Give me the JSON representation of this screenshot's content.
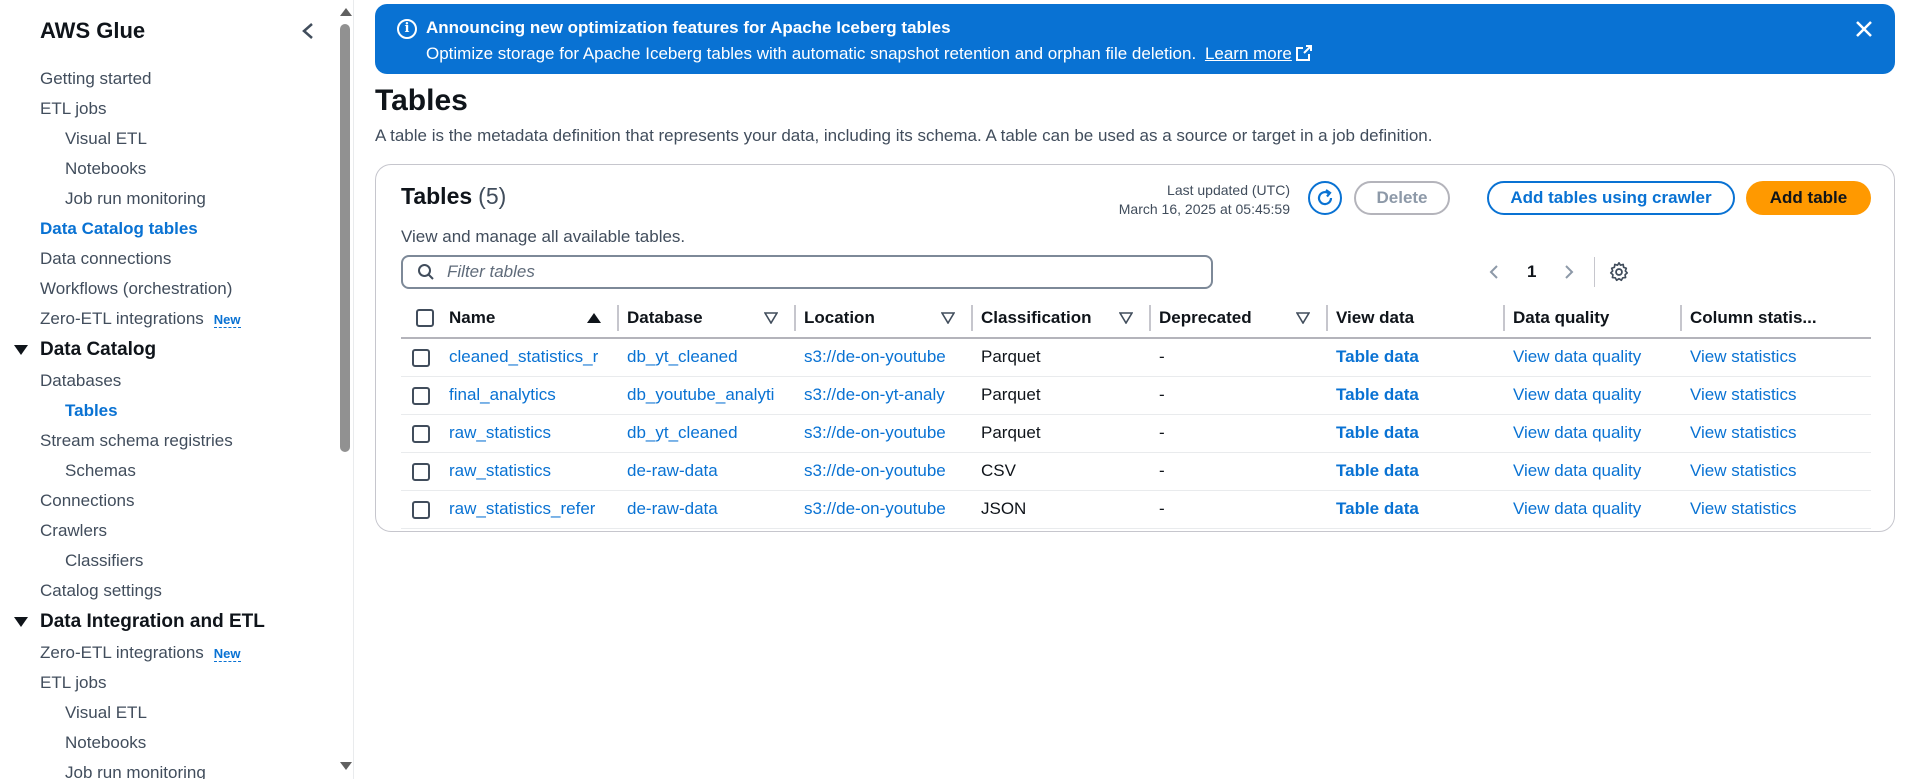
{
  "sidebar": {
    "title": "AWS Glue",
    "items": [
      {
        "label": "Getting started"
      },
      {
        "label": "ETL jobs"
      },
      {
        "label": "Visual ETL"
      },
      {
        "label": "Notebooks"
      },
      {
        "label": "Job run monitoring"
      },
      {
        "label": "Data Catalog tables"
      },
      {
        "label": "Data connections"
      },
      {
        "label": "Workflows (orchestration)"
      },
      {
        "label": "Zero-ETL integrations",
        "badge": "New"
      }
    ],
    "section_catalog": {
      "label": "Data Catalog",
      "items": [
        {
          "label": "Databases"
        },
        {
          "label": "Tables"
        },
        {
          "label": "Stream schema registries"
        },
        {
          "label": "Schemas"
        },
        {
          "label": "Connections"
        },
        {
          "label": "Crawlers"
        },
        {
          "label": "Classifiers"
        },
        {
          "label": "Catalog settings"
        }
      ]
    },
    "section_integration": {
      "label": "Data Integration and ETL",
      "items": [
        {
          "label": "Zero-ETL integrations",
          "badge": "New"
        },
        {
          "label": "ETL jobs"
        },
        {
          "label": "Visual ETL"
        },
        {
          "label": "Notebooks"
        },
        {
          "label": "Job run monitoring"
        }
      ]
    }
  },
  "banner": {
    "title": "Announcing new optimization features for Apache Iceberg tables",
    "text": "Optimize storage for Apache Iceberg tables with automatic snapshot retention and orphan file deletion.",
    "link": "Learn more",
    "color": "#0972d3"
  },
  "page": {
    "title": "Tables",
    "description": "A table is the metadata definition that represents your data, including its schema. A table can be used as a source or target in a job definition."
  },
  "tables_panel": {
    "title": "Tables",
    "count": "(5)",
    "description": "View and manage all available tables.",
    "last_updated_label": "Last updated (UTC)",
    "last_updated_value": "March 16, 2025 at 05:45:59",
    "delete_label": "Delete",
    "crawler_label": "Add tables using crawler",
    "add_label": "Add table",
    "search_placeholder": "Filter tables",
    "page_number": "1",
    "columns": [
      "Name",
      "Database",
      "Location",
      "Classification",
      "Deprecated",
      "View data",
      "Data quality",
      "Column statis..."
    ],
    "rows": [
      {
        "name": "cleaned_statistics_r",
        "database": "db_yt_cleaned",
        "location": "s3://de-on-youtube",
        "classification": "Parquet",
        "deprecated": "-",
        "view_data": "Table data",
        "data_quality": "View data quality",
        "column_stats": "View statistics"
      },
      {
        "name": "final_analytics",
        "database": "db_youtube_analyti",
        "location": "s3://de-on-yt-analy",
        "classification": "Parquet",
        "deprecated": "-",
        "view_data": "Table data",
        "data_quality": "View data quality",
        "column_stats": "View statistics"
      },
      {
        "name": "raw_statistics",
        "database": "db_yt_cleaned",
        "location": "s3://de-on-youtube",
        "classification": "Parquet",
        "deprecated": "-",
        "view_data": "Table data",
        "data_quality": "View data quality",
        "column_stats": "View statistics"
      },
      {
        "name": "raw_statistics",
        "database": "de-raw-data",
        "location": "s3://de-on-youtube",
        "classification": "CSV",
        "deprecated": "-",
        "view_data": "Table data",
        "data_quality": "View data quality",
        "column_stats": "View statistics"
      },
      {
        "name": "raw_statistics_refer",
        "database": "de-raw-data",
        "location": "s3://de-on-youtube",
        "classification": "JSON",
        "deprecated": "-",
        "view_data": "Table data",
        "data_quality": "View data quality",
        "column_stats": "View statistics"
      }
    ]
  },
  "colors": {
    "link": "#0972d3",
    "primary_button": "#ff9900"
  }
}
